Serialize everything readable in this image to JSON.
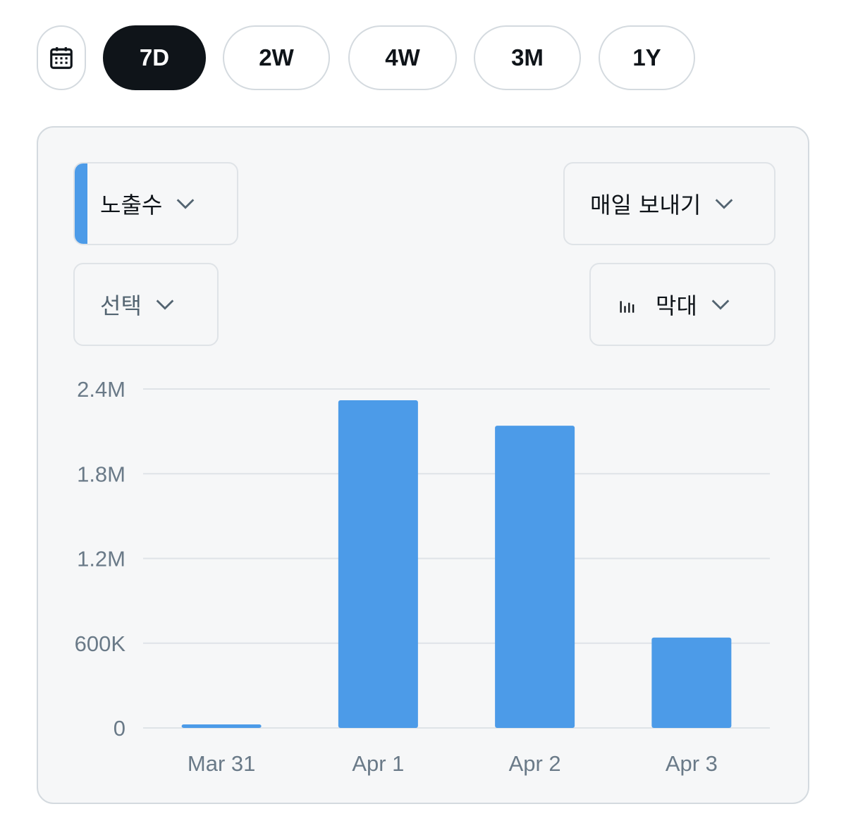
{
  "period_tabs": {
    "calendar_icon": "calendar-icon",
    "items": [
      {
        "label": "7D",
        "active": true
      },
      {
        "label": "2W",
        "active": false
      },
      {
        "label": "4W",
        "active": false
      },
      {
        "label": "3M",
        "active": false
      },
      {
        "label": "1Y",
        "active": false
      }
    ]
  },
  "controls": {
    "metric_label": "노출수",
    "metric_color": "#4c9be8",
    "secondary_label": "선택",
    "frequency_label": "매일 보내기",
    "chart_type_label": "막대",
    "chart_type_icon": "bar-chart-icon"
  },
  "chart_data": {
    "type": "bar",
    "categories": [
      "Mar 31",
      "Apr 1",
      "Apr 2",
      "Apr 3"
    ],
    "values": [
      10000,
      2320000,
      2140000,
      640000
    ],
    "ylim": [
      0,
      2400000
    ],
    "yticks": [
      0,
      600000,
      1200000,
      1800000,
      2400000
    ],
    "ytick_labels": [
      "0",
      "600K",
      "1.2M",
      "1.8M",
      "2.4M"
    ],
    "bar_color": "#4c9be8",
    "grid": true
  }
}
